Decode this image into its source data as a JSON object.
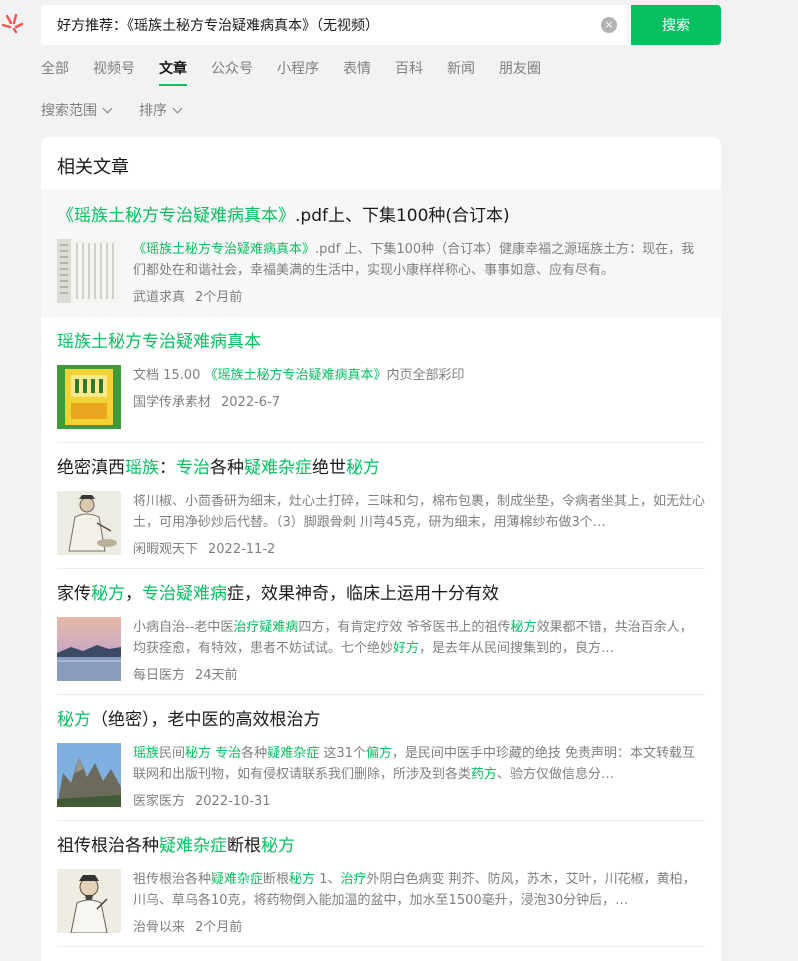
{
  "search": {
    "query": "好方推荐：《瑶族土秘方专治疑难病真本》（无视频）",
    "clear_label": "×",
    "button_label": "搜索"
  },
  "tabs": [
    {
      "label": "全部"
    },
    {
      "label": "视频号"
    },
    {
      "label": "文章"
    },
    {
      "label": "公众号"
    },
    {
      "label": "小程序"
    },
    {
      "label": "表情"
    },
    {
      "label": "百科"
    },
    {
      "label": "新闻"
    },
    {
      "label": "朋友圈"
    }
  ],
  "active_tab": "文章",
  "filters": {
    "scope_label": "搜索范围",
    "sort_label": "排序"
  },
  "panel": {
    "title": "相关文章"
  },
  "articles": [
    {
      "title_parts": [
        {
          "text": "《瑶族土秘方专治疑难病真本》",
          "hl": true
        },
        {
          "text": ".pdf上、下集100种(合订本)",
          "hl": false
        }
      ],
      "desc_parts": [
        {
          "text": "《瑶族土秘方专治疑难病真本》",
          "hl": true
        },
        {
          "text": ".pdf 上、下集100种（合订本）健康幸福之源瑶族土方：现在，我们都处在和谐社会，幸福美满的生活中，实现小康样样称心、事事如意、应有尽有。",
          "hl": false
        }
      ],
      "source": "武道求真",
      "time": "2个月前"
    },
    {
      "title_parts": [
        {
          "text": "瑶族土秘方专治疑难病真本",
          "hl": true
        }
      ],
      "desc_parts": [
        {
          "text": "文档 15.00 ",
          "hl": false
        },
        {
          "text": "《瑶族土秘方专治疑难病真本》",
          "hl": true
        },
        {
          "text": "内页全部彩印",
          "hl": false
        }
      ],
      "source": "国学传承素材",
      "time": "2022-6-7"
    },
    {
      "title_parts": [
        {
          "text": "绝密滇西",
          "hl": false
        },
        {
          "text": "瑶族",
          "hl": true
        },
        {
          "text": "：",
          "hl": false
        },
        {
          "text": "专治",
          "hl": true
        },
        {
          "text": "各种",
          "hl": false
        },
        {
          "text": "疑难杂症",
          "hl": true
        },
        {
          "text": "绝世",
          "hl": false
        },
        {
          "text": "秘方",
          "hl": true
        }
      ],
      "desc_parts": [
        {
          "text": "将川椒、小茴香研为细末，灶心土打碎，三味和匀，棉布包裹，制成坐垫，令病者坐其上，如无灶心土，可用净砂炒后代替。（3）脚跟骨刺 川芎45克，研为细末，用薄棉纱布做3个…",
          "hl": false
        }
      ],
      "source": "闲暇观天下",
      "time": "2022-11-2"
    },
    {
      "title_parts": [
        {
          "text": "家传",
          "hl": false
        },
        {
          "text": "秘方",
          "hl": true
        },
        {
          "text": "，",
          "hl": false
        },
        {
          "text": "专治疑难病",
          "hl": true
        },
        {
          "text": "症，效果神奇，临床上运用十分有效",
          "hl": false
        }
      ],
      "desc_parts": [
        {
          "text": "小病自治--老中医",
          "hl": false
        },
        {
          "text": "治疗疑难病",
          "hl": true
        },
        {
          "text": "四方，有肯定疗效 爷爷医书上的祖传",
          "hl": false
        },
        {
          "text": "秘方",
          "hl": true
        },
        {
          "text": "效果都不错，共治百余人，均获痊愈，有特效，患者不妨试试。七个绝妙",
          "hl": false
        },
        {
          "text": "好方",
          "hl": true
        },
        {
          "text": "，是去年从民间搜集到的，良方…",
          "hl": false
        }
      ],
      "source": "每日医方",
      "time": "24天前"
    },
    {
      "title_parts": [
        {
          "text": "秘方",
          "hl": true
        },
        {
          "text": "（绝密），老中医的高效根治方",
          "hl": false
        }
      ],
      "desc_parts": [
        {
          "text": "瑶族",
          "hl": true
        },
        {
          "text": "民间",
          "hl": false
        },
        {
          "text": "秘方 专治",
          "hl": true
        },
        {
          "text": "各种",
          "hl": false
        },
        {
          "text": "疑难杂症",
          "hl": true
        },
        {
          "text": " 这31个",
          "hl": false
        },
        {
          "text": "偏方",
          "hl": true
        },
        {
          "text": "，是民间中医手中珍藏的绝技 免责声明：本文转载互联网和出版刊物，如有侵权请联系我们删除，所涉及到各类",
          "hl": false
        },
        {
          "text": "药方",
          "hl": true
        },
        {
          "text": "、验方仅做信息分…",
          "hl": false
        }
      ],
      "source": "医家医方",
      "time": "2022-10-31"
    },
    {
      "title_parts": [
        {
          "text": "祖传根治各种",
          "hl": false
        },
        {
          "text": "疑难杂症",
          "hl": true
        },
        {
          "text": "断根",
          "hl": false
        },
        {
          "text": "秘方",
          "hl": true
        }
      ],
      "desc_parts": [
        {
          "text": "祖传根治各种",
          "hl": false
        },
        {
          "text": "疑难杂症",
          "hl": true
        },
        {
          "text": "断根",
          "hl": false
        },
        {
          "text": "秘方",
          "hl": true
        },
        {
          "text": " 1、",
          "hl": false
        },
        {
          "text": "治疗",
          "hl": true
        },
        {
          "text": "外阴白色病变 荆芥、防风，苏木，艾叶，川花椒，黄柏，川乌、草乌各10克，将药物倒入能加温的盆中，加水至1500毫升，浸泡30分钟后，…",
          "hl": false
        }
      ],
      "source": "治骨以来",
      "time": "2个月前"
    }
  ],
  "colors": {
    "accent": "#07c160",
    "background": "#f2f2f2",
    "muted_text": "#7f7f7f"
  }
}
